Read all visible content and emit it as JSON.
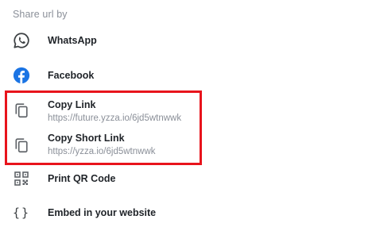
{
  "header": {
    "title": "Share url by"
  },
  "items": {
    "whatsapp": {
      "label": "WhatsApp",
      "icon": "whatsapp-icon"
    },
    "facebook": {
      "label": "Facebook",
      "icon": "facebook-icon",
      "color": "#1b74e4"
    },
    "copy_link": {
      "label": "Copy Link",
      "url": "https://future.yzza.io/6jd5wtnwwk",
      "icon": "copy-icon"
    },
    "copy_short_link": {
      "label": "Copy Short Link",
      "url": "https://yzza.io/6jd5wtnwwk",
      "icon": "copy-icon"
    },
    "qr": {
      "label": "Print QR Code",
      "icon": "qr-code-icon"
    },
    "embed": {
      "label": "Embed in your website",
      "icon": "code-braces-icon",
      "glyph": "{}"
    }
  },
  "highlight_color": "#e8141c"
}
